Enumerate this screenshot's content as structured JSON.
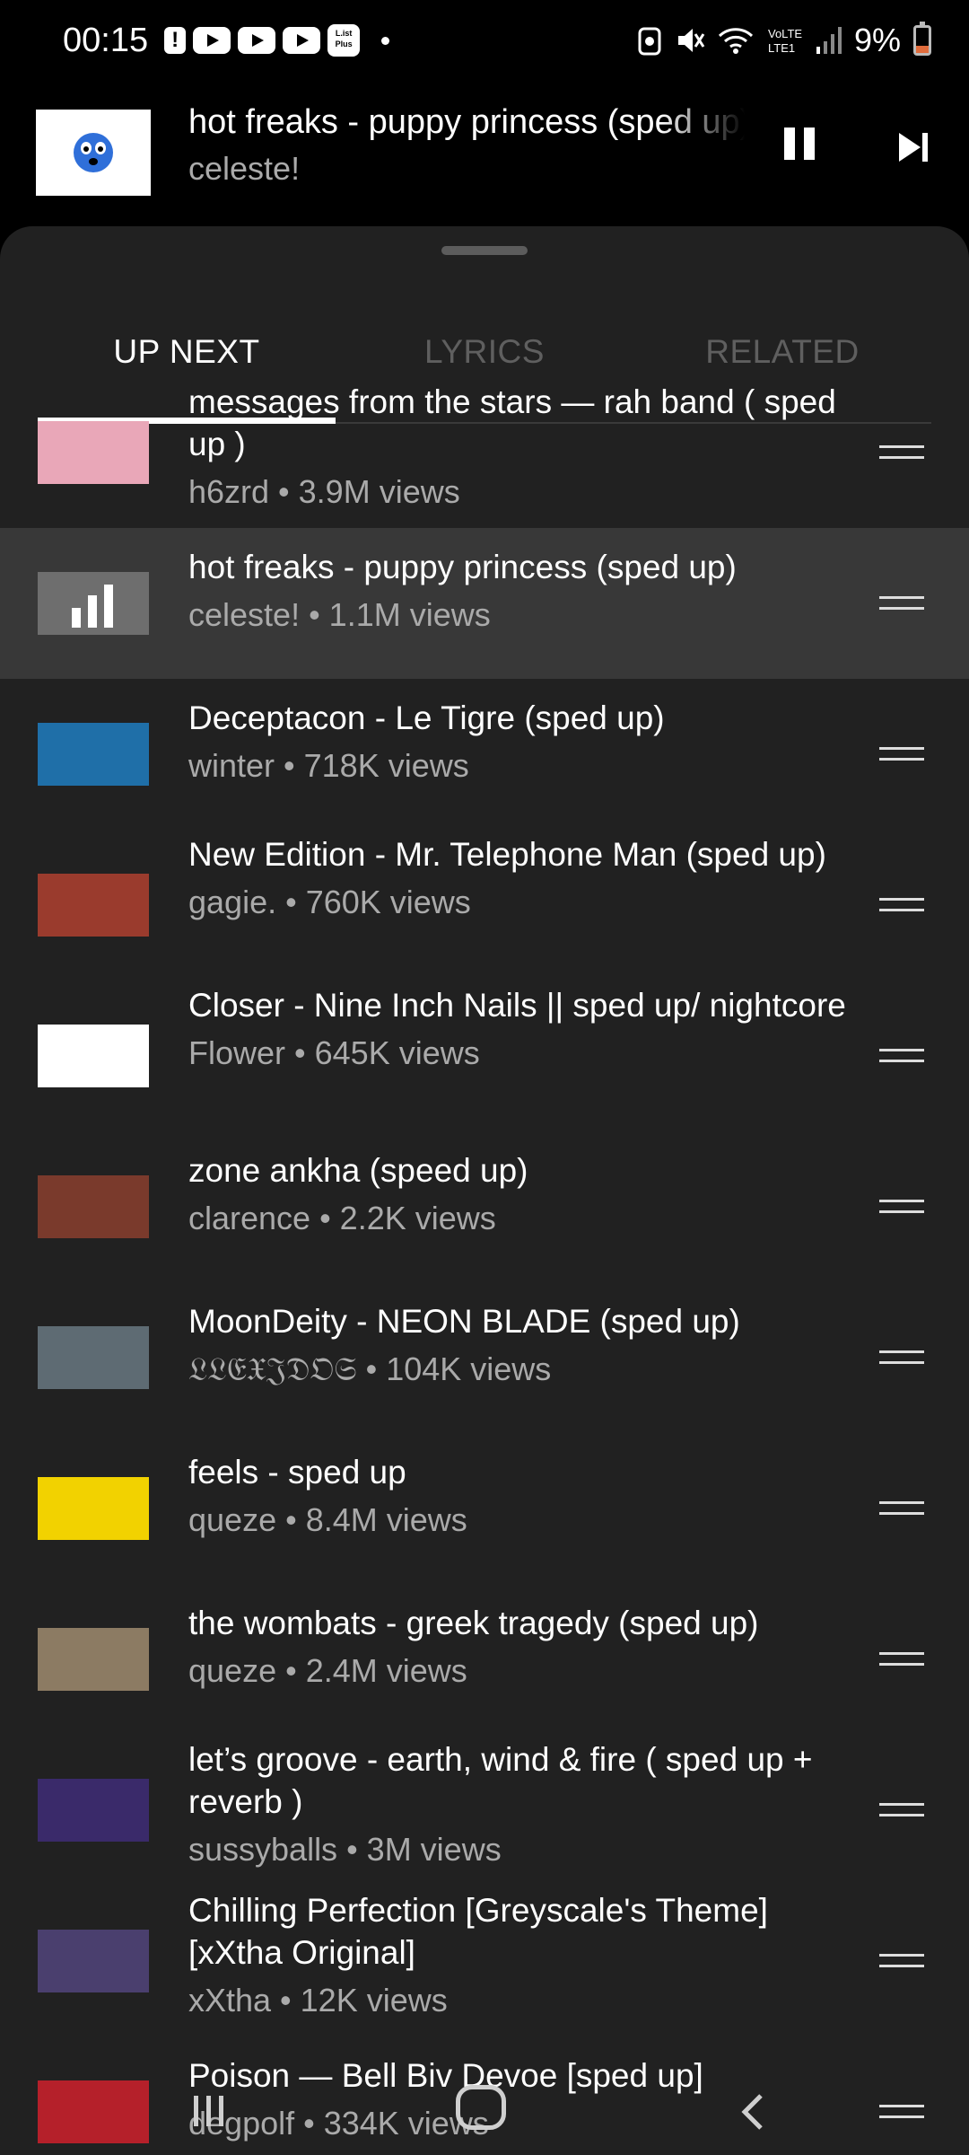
{
  "status_bar": {
    "time": "00:15",
    "alert_icon": "!",
    "app_icon_label": "L.ist Plus",
    "battery": "9%",
    "battery_level": 0.09,
    "battery_color": "#e06c3c"
  },
  "mini_player": {
    "title": "hot freaks - puppy princess (sped up)",
    "artist": "celeste!",
    "pause_icon": "pause-icon",
    "next_icon": "skip-next-icon"
  },
  "tabs": [
    {
      "label": "UP NEXT",
      "active": true
    },
    {
      "label": "LYRICS",
      "active": false
    },
    {
      "label": "RELATED",
      "active": false
    }
  ],
  "queue": [
    {
      "title": "messages from the stars — rah band ( sped up )",
      "meta": "h6zrd • 3.9M views",
      "thumb": "#e9a7b8"
    },
    {
      "title": "hot freaks - puppy princess (sped up)",
      "meta": "celeste! • 1.1M views",
      "thumb": "#8a8a8a",
      "current": true
    },
    {
      "title": "Deceptacon - Le Tigre (sped up)",
      "meta": "winter • 718K views",
      "thumb": "#1f6fa8"
    },
    {
      "title": "New Edition - Mr. Telephone Man (sped up)",
      "meta": "gagie. • 760K views",
      "thumb": "#9a3b2d"
    },
    {
      "title": "Closer - Nine Inch Nails || sped up/ nightcore",
      "meta": "Flower • 645K views",
      "thumb": "#ffffff"
    },
    {
      "title": "zone ankha (speed up)",
      "meta": "clarence • 2.2K views",
      "thumb": "#7a3a2c"
    },
    {
      "title": "MoonDeity - NEON BLADE (sped up)",
      "meta": "𝔏𝔏𝔈𝔛𝔍𝔇𝔒𝔖 • 104K views",
      "thumb": "#5e6b73"
    },
    {
      "title": "feels - sped up",
      "meta": "queze • 8.4M views",
      "thumb": "#f2d200"
    },
    {
      "title": "the wombats - greek tragedy (sped up)",
      "meta": "queze • 2.4M views",
      "thumb": "#8c7b63"
    },
    {
      "title": "let’s groove - earth, wind & fire ( sped up + reverb )",
      "meta": "sussyballs • 3M views",
      "thumb": "#3a2a6a"
    },
    {
      "title": "Chilling Perfection [Greyscale's Theme] [xXtha Original]",
      "meta": "xXtha • 12K views",
      "thumb": "#4a3f6e"
    },
    {
      "title": "Poison — Bell Biv Devoe [sped up]",
      "meta": "degpolf • 334K views",
      "thumb": "#b5202a"
    }
  ]
}
